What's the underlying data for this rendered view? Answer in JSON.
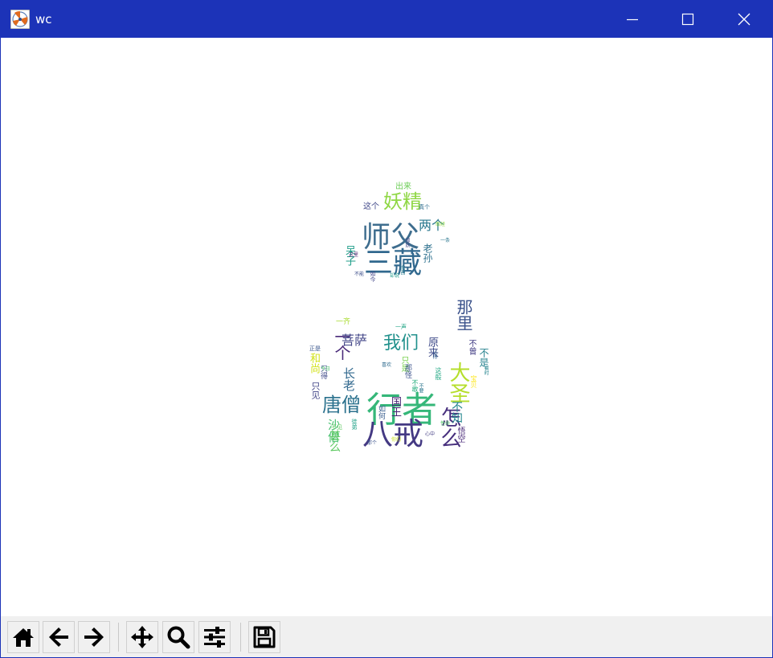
{
  "window": {
    "title": "wc"
  },
  "title_controls": {
    "minimize_icon": "minimize-icon",
    "maximize_icon": "maximize-icon",
    "close_icon": "close-icon"
  },
  "wordcloud": {
    "words": [
      {
        "text": "行者",
        "color": "#35b779"
      },
      {
        "text": "师父",
        "color": "#3e6d8e"
      },
      {
        "text": "三藏",
        "color": "#31688e"
      },
      {
        "text": "八戒",
        "color": "#443983"
      },
      {
        "text": "大圣",
        "color": "#b5de2b"
      },
      {
        "text": "唐僧",
        "color": "#2c728e"
      },
      {
        "text": "妖精",
        "color": "#8fd744"
      },
      {
        "text": "我们",
        "color": "#21918c"
      },
      {
        "text": "怎么",
        "color": "#472f7d"
      },
      {
        "text": "那里",
        "color": "#3b528b"
      },
      {
        "text": "一个",
        "color": "#482878"
      },
      {
        "text": "菩萨",
        "color": "#414487"
      },
      {
        "text": "两个",
        "color": "#2a788e"
      },
      {
        "text": "沙僧",
        "color": "#46c06f"
      },
      {
        "text": "长老",
        "color": "#31688e"
      },
      {
        "text": "和尚",
        "color": "#d2e21b"
      },
      {
        "text": "国王",
        "color": "#482475"
      },
      {
        "text": "不知",
        "color": "#24868e"
      },
      {
        "text": "原来",
        "color": "#3e4a89"
      },
      {
        "text": "不是",
        "color": "#26828e"
      },
      {
        "text": "甚么",
        "color": "#5ec962"
      },
      {
        "text": "呆子",
        "color": "#1f9e89"
      },
      {
        "text": "只见",
        "color": "#414487"
      },
      {
        "text": "只是",
        "color": "#7ad151"
      },
      {
        "text": "这个",
        "color": "#3f4788"
      },
      {
        "text": "出来",
        "color": "#6ece58"
      },
      {
        "text": "悟空",
        "color": "#482878"
      },
      {
        "text": "老孙",
        "color": "#2d708e"
      },
      {
        "text": "不曾",
        "color": "#433e85"
      },
      {
        "text": "宝贝",
        "color": "#fde725"
      },
      {
        "text": "那怪",
        "color": "#3b528b"
      },
      {
        "text": "不敢",
        "color": "#29af7f"
      },
      {
        "text": "如何",
        "color": "#365c8d"
      },
      {
        "text": "这般",
        "color": "#22a884"
      },
      {
        "text": "不见",
        "color": "#5ec962"
      },
      {
        "text": "只得",
        "color": "#3e4989"
      },
      {
        "text": "徒弟",
        "color": "#1fa187"
      },
      {
        "text": "一齐",
        "color": "#aadc32"
      },
      {
        "text": "如今",
        "color": "#414487"
      },
      {
        "text": "真个",
        "color": "#2e6e8e"
      },
      {
        "text": "一声",
        "color": "#20a486"
      },
      {
        "text": "正是",
        "color": "#39568c"
      },
      {
        "text": "认得",
        "color": "#355f8d"
      },
      {
        "text": "今日",
        "color": "#4ac16d"
      },
      {
        "text": "不要",
        "color": "#2b758e"
      },
      {
        "text": "那个",
        "color": "#3b528b"
      },
      {
        "text": "看时",
        "color": "#25848e"
      },
      {
        "text": "心中",
        "color": "#433d84"
      },
      {
        "text": "你们",
        "color": "#c8e020"
      },
      {
        "text": "喜欢",
        "color": "#2f6b8e"
      },
      {
        "text": "这里",
        "color": "#48186a"
      },
      {
        "text": "却说",
        "color": "#1e9b8a"
      },
      {
        "text": "性命",
        "color": "#52c569"
      },
      {
        "text": "东西",
        "color": "#287d8e"
      },
      {
        "text": "一条",
        "color": "#2a768e"
      },
      {
        "text": "那妖",
        "color": "#404688"
      },
      {
        "text": "不能",
        "color": "#3d4e8a"
      },
      {
        "text": "取经",
        "color": "#90d743"
      }
    ]
  },
  "toolbar": {
    "buttons": [
      {
        "name": "home-button",
        "icon": "home-icon"
      },
      {
        "name": "back-button",
        "icon": "arrow-left-icon"
      },
      {
        "name": "forward-button",
        "icon": "arrow-right-icon"
      },
      {
        "name": "pan-button",
        "icon": "move-icon"
      },
      {
        "name": "zoom-button",
        "icon": "magnifier-icon"
      },
      {
        "name": "configure-subplots-button",
        "icon": "sliders-icon"
      },
      {
        "name": "save-button",
        "icon": "floppy-disk-icon"
      }
    ]
  }
}
